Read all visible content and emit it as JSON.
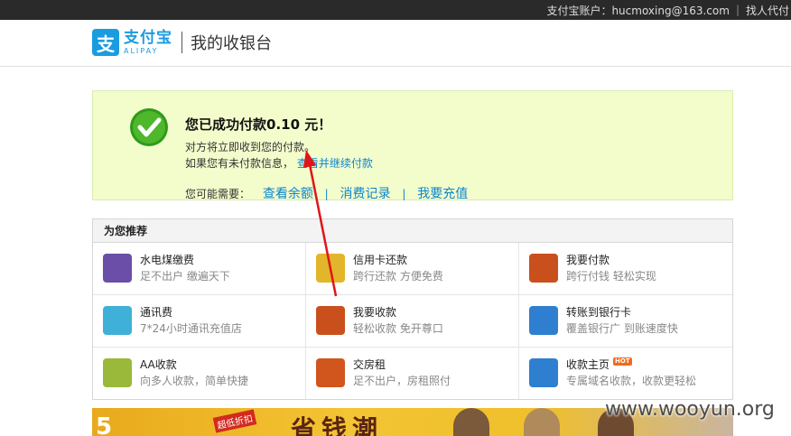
{
  "topbar": {
    "account_label": "支付宝账户：hucmoxing@163.com",
    "separator": "|",
    "link": "找人代付"
  },
  "header": {
    "logo_cn": "支付宝",
    "logo_en": "ALIPAY",
    "title": "我的收银台"
  },
  "success": {
    "title": "您已成功付款0.10 元！",
    "line1": "对方将立即收到您的付款。",
    "line2_prefix": "如果您有未付款信息，",
    "line2_link": "查看并继续付款",
    "links_label": "您可能需要：",
    "links": [
      "查看余额",
      "消费记录",
      "我要充值"
    ],
    "link_sep": "|"
  },
  "recommend": {
    "title": "为您推荐",
    "items": [
      {
        "title": "水电煤缴费",
        "subtitle": "足不出户  缴遍天下",
        "icon": "utilities-icon",
        "color": "#6b4ea8"
      },
      {
        "title": "信用卡还款",
        "subtitle": "跨行还款  方便免费",
        "icon": "credit-card-icon",
        "color": "#e2b52a"
      },
      {
        "title": "我要付款",
        "subtitle": "跨行付钱  轻松实现",
        "icon": "pay-icon",
        "color": "#c9501d"
      },
      {
        "title": "通讯费",
        "subtitle": "7*24小时通讯充值店",
        "icon": "phone-icon",
        "color": "#3fb0d8"
      },
      {
        "title": "我要收款",
        "subtitle": "轻松收款  免开尊口",
        "icon": "receive-icon",
        "color": "#c9501d"
      },
      {
        "title": "转账到银行卡",
        "subtitle": "覆盖银行广  到账速度快",
        "icon": "bank-transfer-icon",
        "color": "#2f7fd0"
      },
      {
        "title": "AA收款",
        "subtitle": "向多人收款，简单快捷",
        "icon": "aa-icon",
        "color": "#9ab83a"
      },
      {
        "title": "交房租",
        "subtitle": "足不出户，房租照付",
        "icon": "house-icon",
        "color": "#d0561d"
      },
      {
        "title": "收款主页",
        "subtitle": "专属域名收款，收款更轻松",
        "icon": "homepage-icon",
        "color": "#2f7fd0",
        "badge": "HOT"
      }
    ]
  },
  "banner": {
    "big_text": "省钱潮",
    "tag": "超低折扣",
    "number": "5"
  },
  "watermark": "www.wooyun.org"
}
